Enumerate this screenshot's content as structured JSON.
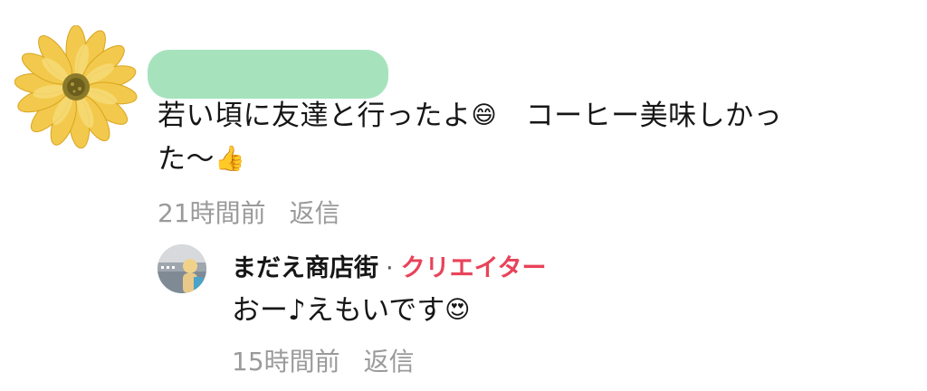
{
  "comment": {
    "avatar_icon": "sunflower-illustration-icon",
    "text_line1": "若い頃に友達と行ったよ",
    "emoji1": "😄",
    "text_line1b": "　コーヒー美味しかっ",
    "text_line2": "た〜",
    "emoji2": "👍",
    "time": "21時間前",
    "reply_label": "返信"
  },
  "reply": {
    "avatar_icon": "creator-avatar-icon",
    "author": "まだえ商店街",
    "separator": "·",
    "badge": "クリエイター",
    "text": "おー♪えもいです",
    "emoji": "😍",
    "time": "15時間前",
    "reply_label": "返信"
  },
  "colors": {
    "redaction": "#a6e3bd",
    "creator_badge": "#e8435a",
    "meta_text": "#9a9a9a"
  }
}
